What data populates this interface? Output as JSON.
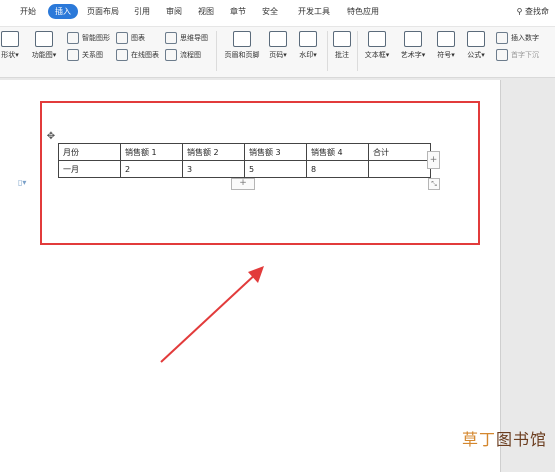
{
  "menubar": {
    "items": [
      "开始",
      "插入",
      "页面布局",
      "引用",
      "审阅",
      "视图",
      "章节",
      "安全",
      "开发工具",
      "特色应用"
    ],
    "active": "插入",
    "search_label": "查找命"
  },
  "ribbon": {
    "shape_label": "形状",
    "function_label": "功能图",
    "smart_shape_label": "智能图形",
    "chart_label": "图表",
    "mindmap_label": "思维导图",
    "relation_label": "关系图",
    "online_chart_label": "在线图表",
    "flowchart_label": "流程图",
    "header_footer_label": "页眉和页脚",
    "page_number_label": "页码",
    "watermark_label": "水印",
    "comment_label": "批注",
    "textbox_label": "文本框",
    "wordart_label": "艺术字",
    "symbol_label": "符号",
    "formula_label": "公式",
    "insert_number_label": "插入数字",
    "initial_drop_label": "首字下沉"
  },
  "table": {
    "header": [
      "月份",
      "销售额 1",
      "销售额 2",
      "销售额 3",
      "销售额 4",
      "合计"
    ],
    "rows": [
      [
        "一月",
        "2",
        "3",
        "5",
        "8",
        ""
      ]
    ]
  },
  "watermark": {
    "text_prefix": "草丁",
    "text_main": "图书馆"
  },
  "colors": {
    "accent": "#2b79d9",
    "highlight_red": "#e23b3b"
  }
}
